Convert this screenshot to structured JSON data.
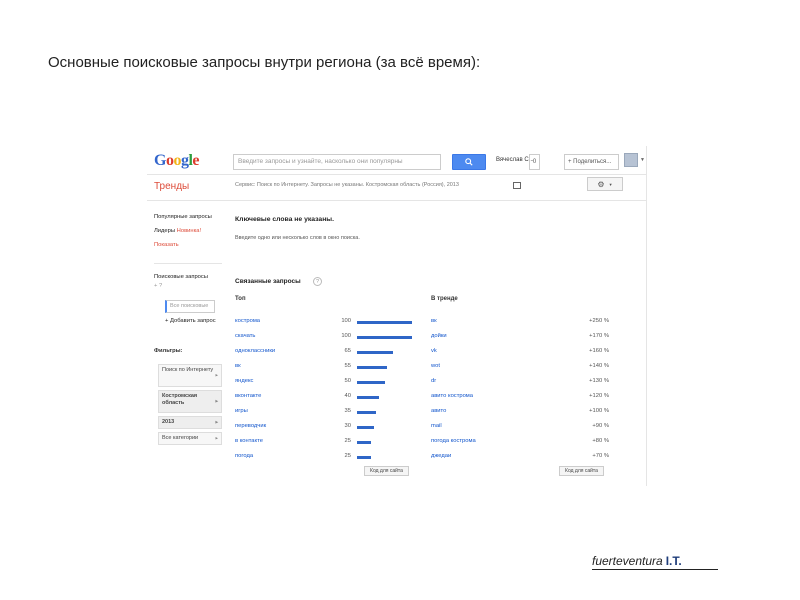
{
  "slide_title": "Основные поисковые запросы внутри региона (за всё время):",
  "header": {
    "logo": [
      "G",
      "o",
      "o",
      "g",
      "l",
      "e"
    ],
    "search_placeholder": "Введите запросы и узнайте, насколько они популярны",
    "user": "Вячеслав С...",
    "notifications": "0",
    "share": "+ Поделиться...",
    "search_icon": "search-icon",
    "gear_icon": "gear-icon"
  },
  "app_title": "Тренды",
  "service_text": "Сервис: Поиск по Интернету. Запросы не указаны. Костромская область (Россия), 2013",
  "sidebar": {
    "popular": "Популярные запросы",
    "leaders": "Лидеры",
    "leaders_new": "Новинка!",
    "show": "Показать",
    "search_queries": "Поисковые запросы",
    "all_search": "Все поисковые",
    "add_query": "+ Добавить запрос",
    "filters": "Фильтры:",
    "filter_items": [
      "Поиск по Интернету",
      "Костромская область",
      "2013",
      "Все категории"
    ]
  },
  "main": {
    "heading": "Ключевые слова не указаны.",
    "hint": "Введите одно или несколько слов в окно поиска.",
    "related": "Связанные запросы",
    "help": "?",
    "top_header": "Топ",
    "trend_header": "В тренде",
    "export_label": "Код для сайта"
  },
  "top_queries": [
    {
      "q": "кострома",
      "v": "100",
      "n": 100
    },
    {
      "q": "скачать",
      "v": "100",
      "n": 100
    },
    {
      "q": "одноклассники",
      "v": "65",
      "n": 65
    },
    {
      "q": "вк",
      "v": "55",
      "n": 55
    },
    {
      "q": "яндекс",
      "v": "50",
      "n": 50
    },
    {
      "q": "вконтакте",
      "v": "40",
      "n": 40
    },
    {
      "q": "игры",
      "v": "35",
      "n": 35
    },
    {
      "q": "переводчик",
      "v": "30",
      "n": 30
    },
    {
      "q": "в контакте",
      "v": "25",
      "n": 25
    },
    {
      "q": "погода",
      "v": "25",
      "n": 25
    }
  ],
  "trend_queries": [
    {
      "q": "вк",
      "v": "+250 %"
    },
    {
      "q": "дойки",
      "v": "+170 %"
    },
    {
      "q": "vk",
      "v": "+160 %"
    },
    {
      "q": "wot",
      "v": "+140 %"
    },
    {
      "q": "dr",
      "v": "+130 %"
    },
    {
      "q": "авито кострома",
      "v": "+120 %"
    },
    {
      "q": "авито",
      "v": "+100 %"
    },
    {
      "q": "mail",
      "v": "+90 %"
    },
    {
      "q": "погода кострома",
      "v": "+80 %"
    },
    {
      "q": "джедаи",
      "v": "+70 %"
    }
  ],
  "brand": {
    "name": "fuerteventura",
    "suffix": "I.T."
  },
  "colors": {
    "accent": "#4d8af0",
    "bar": "#2f66c7",
    "red": "#dd4b39",
    "link": "#1155cc"
  }
}
